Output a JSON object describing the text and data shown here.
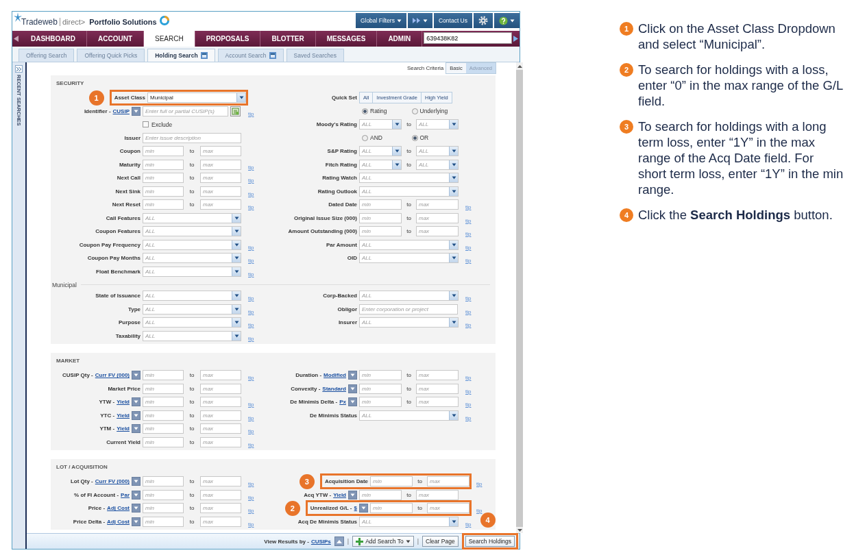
{
  "header": {
    "brand": "Tradeweb",
    "tagline": "direct>",
    "product": "Portfolio Solutions",
    "tools": [
      {
        "kind": "label",
        "label": "Global Filters",
        "menu": true
      },
      {
        "kind": "forward",
        "menu": true
      },
      {
        "kind": "label",
        "label": "Contact Us",
        "menu": false
      },
      {
        "kind": "gear",
        "menu": false
      },
      {
        "kind": "help",
        "menu": true
      }
    ]
  },
  "nav": {
    "tabs": [
      {
        "label": "DASHBOARD",
        "selected": false
      },
      {
        "label": "ACCOUNT",
        "selected": false
      },
      {
        "label": "SEARCH",
        "selected": true
      },
      {
        "label": "PROPOSALS",
        "selected": false
      },
      {
        "label": "BLOTTER",
        "selected": false
      },
      {
        "label": "MESSAGES",
        "selected": false
      },
      {
        "label": "ADMIN",
        "selected": false
      }
    ],
    "search": {
      "value": "639438K82"
    }
  },
  "subtabs": [
    {
      "label": "Offering Search",
      "selected": false,
      "icon": false
    },
    {
      "label": "Offering Quick Picks",
      "selected": false,
      "icon": false
    },
    {
      "label": "Holding Search",
      "selected": true,
      "icon": true
    },
    {
      "label": "Account Search",
      "selected": false,
      "icon": true
    },
    {
      "label": "Saved Searches",
      "selected": false,
      "icon": false
    }
  ],
  "sidebar": {
    "title": "RECENT SEARCHES"
  },
  "criteria": {
    "label": "Search Criteria",
    "modes": [
      {
        "label": "Basic",
        "selected": false
      },
      {
        "label": "Advanced",
        "selected": true
      }
    ]
  },
  "sections": [
    {
      "title": "SECURITY",
      "rows": [
        {
          "kind": "fields",
          "left": {
            "kind": "select",
            "label": "Asset Class",
            "value": "Municipal",
            "callout": {
              "number": "1"
            }
          },
          "right": {
            "kind": "buttons",
            "label": "Quick Set",
            "buttons": [
              "All",
              "Investment Grade",
              "High Yield"
            ]
          }
        },
        {
          "kind": "fields",
          "left": {
            "kind": "text",
            "label": "Identifier -",
            "link": "CUSIP",
            "menu": true,
            "placeholder": "Enter full or partial CUSIP(s)",
            "action": true,
            "tip": "tip"
          },
          "right": {
            "kind": "radios",
            "options": [
              {
                "label": "Rating",
                "selected": true
              },
              {
                "label": "Underlying",
                "selected": false
              }
            ]
          }
        },
        {
          "kind": "fields",
          "left": {
            "kind": "checkbox",
            "label": "Exclude",
            "checked": false
          },
          "right": {
            "kind": "select_range",
            "label": "Moody's Rating",
            "selects": [
              {
                "placeholder": "ALL"
              },
              {
                "placeholder": "ALL"
              }
            ],
            "sep": "to"
          }
        },
        {
          "kind": "fields",
          "left": {
            "kind": "text",
            "label": "Issuer",
            "placeholder": "Enter issue description"
          },
          "right": {
            "kind": "radios",
            "options": [
              {
                "label": "AND",
                "selected": false
              },
              {
                "label": "OR",
                "selected": true
              }
            ]
          }
        },
        {
          "kind": "fields",
          "left": {
            "kind": "range",
            "label": "Coupon",
            "inputs": [
              {
                "placeholder": "min"
              },
              {
                "placeholder": "max"
              }
            ],
            "sep": "to"
          },
          "right": {
            "kind": "select_range",
            "label": "S&P Rating",
            "selects": [
              {
                "placeholder": "ALL"
              },
              {
                "placeholder": "ALL"
              }
            ],
            "sep": "to"
          }
        },
        {
          "kind": "fields",
          "left": {
            "kind": "range",
            "label": "Maturity",
            "inputs": [
              {
                "placeholder": "min"
              },
              {
                "placeholder": "max"
              }
            ],
            "sep": "to",
            "tip": "tip"
          },
          "right": {
            "kind": "select_range",
            "label": "Fitch Rating",
            "selects": [
              {
                "placeholder": "ALL"
              },
              {
                "placeholder": "ALL"
              }
            ],
            "sep": "to"
          }
        },
        {
          "kind": "fields",
          "left": {
            "kind": "range",
            "label": "Next Call",
            "inputs": [
              {
                "placeholder": "min"
              },
              {
                "placeholder": "max"
              }
            ],
            "sep": "to",
            "tip": "tip"
          },
          "right": {
            "kind": "select",
            "label": "Rating Watch",
            "placeholder": "ALL"
          }
        },
        {
          "kind": "fields",
          "left": {
            "kind": "range",
            "label": "Next Sink",
            "inputs": [
              {
                "placeholder": "min"
              },
              {
                "placeholder": "max"
              }
            ],
            "sep": "to",
            "tip": "tip"
          },
          "right": {
            "kind": "select",
            "label": "Rating Outlook",
            "placeholder": "ALL"
          }
        },
        {
          "kind": "fields",
          "left": {
            "kind": "range",
            "label": "Next Reset",
            "inputs": [
              {
                "placeholder": "min"
              },
              {
                "placeholder": "max"
              }
            ],
            "sep": "to",
            "tip": "tip"
          },
          "right": {
            "kind": "range",
            "label": "Dated Date",
            "inputs": [
              {
                "placeholder": "min"
              },
              {
                "placeholder": "max"
              }
            ],
            "sep": "to",
            "tip": "tip"
          }
        },
        {
          "kind": "fields",
          "left": {
            "kind": "select",
            "label": "Call Features",
            "placeholder": "ALL"
          },
          "right": {
            "kind": "range",
            "label": "Original Issue Size (000)",
            "inputs": [
              {
                "placeholder": "min"
              },
              {
                "placeholder": "max"
              }
            ],
            "sep": "to",
            "tip": "tip"
          }
        },
        {
          "kind": "fields",
          "left": {
            "kind": "select",
            "label": "Coupon Features",
            "placeholder": "ALL"
          },
          "right": {
            "kind": "range",
            "label": "Amount Outstanding (000)",
            "inputs": [
              {
                "placeholder": "min"
              },
              {
                "placeholder": "max"
              }
            ],
            "sep": "to",
            "tip": "tip"
          }
        },
        {
          "kind": "fields",
          "left": {
            "kind": "select",
            "label": "Coupon Pay Frequency",
            "placeholder": "ALL",
            "tip": "tip"
          },
          "right": {
            "kind": "select",
            "label": "Par Amount",
            "placeholder": "ALL",
            "tip": "tip"
          }
        },
        {
          "kind": "fields",
          "left": {
            "kind": "select",
            "label": "Coupon Pay Months",
            "placeholder": "ALL",
            "tip": "tip"
          },
          "right": {
            "kind": "select",
            "label": "OID",
            "placeholder": "ALL",
            "tip": "tip"
          }
        },
        {
          "kind": "fields",
          "left": {
            "kind": "select",
            "label": "Float Benchmark",
            "placeholder": "ALL",
            "tip": "tip"
          }
        },
        {
          "kind": "divider",
          "label": "Municipal"
        },
        {
          "kind": "fields",
          "left": {
            "kind": "select",
            "label": "State of Issuance",
            "placeholder": "ALL",
            "tip": "tip"
          },
          "right": {
            "kind": "select",
            "label": "Corp-Backed",
            "placeholder": "ALL",
            "tip": "tip"
          }
        },
        {
          "kind": "fields",
          "left": {
            "kind": "select",
            "label": "Type",
            "placeholder": "ALL",
            "tip": "tip"
          },
          "right": {
            "kind": "text",
            "label": "Obligor",
            "placeholder": "Enter corporation or project",
            "tip": "tip"
          }
        },
        {
          "kind": "fields",
          "left": {
            "kind": "select",
            "label": "Purpose",
            "placeholder": "ALL",
            "tip": "tip"
          },
          "right": {
            "kind": "select",
            "label": "Insurer",
            "placeholder": "ALL",
            "tip": "tip"
          }
        },
        {
          "kind": "fields",
          "left": {
            "kind": "select",
            "label": "Taxability",
            "placeholder": "ALL",
            "tip": "tip"
          }
        }
      ]
    },
    {
      "title": "MARKET",
      "rows": [
        {
          "kind": "fields",
          "left": {
            "kind": "range",
            "label": "CUSIP Qty -",
            "link": "Curr FV (000)",
            "menu": true,
            "inputs": [
              {
                "placeholder": "min"
              },
              {
                "placeholder": "max"
              }
            ],
            "sep": "to",
            "tip": "tip"
          },
          "right": {
            "kind": "range",
            "label": "Duration -",
            "link": "Modified",
            "menu": true,
            "inputs": [
              {
                "placeholder": "min"
              },
              {
                "placeholder": "max"
              }
            ],
            "sep": "to",
            "tip": "tip"
          }
        },
        {
          "kind": "fields",
          "left": {
            "kind": "range",
            "label": "Market Price",
            "inputs": [
              {
                "placeholder": "min"
              },
              {
                "placeholder": "max"
              }
            ],
            "sep": "to"
          },
          "right": {
            "kind": "range",
            "label": "Convexity -",
            "link": "Standard",
            "menu": true,
            "inputs": [
              {
                "placeholder": "min"
              },
              {
                "placeholder": "max"
              }
            ],
            "sep": "to",
            "tip": "tip"
          }
        },
        {
          "kind": "fields",
          "left": {
            "kind": "range",
            "label": "YTW -",
            "link": "Yield",
            "menu": true,
            "inputs": [
              {
                "placeholder": "min"
              },
              {
                "placeholder": "max"
              }
            ],
            "sep": "to",
            "tip": "tip"
          },
          "right": {
            "kind": "range",
            "label": "De Minimis Delta -",
            "link": "Px",
            "menu": true,
            "inputs": [
              {
                "placeholder": "min"
              },
              {
                "placeholder": "max"
              }
            ],
            "sep": "to",
            "tip": "tip"
          }
        },
        {
          "kind": "fields",
          "left": {
            "kind": "range",
            "label": "YTC -",
            "link": "Yield",
            "menu": true,
            "inputs": [
              {
                "placeholder": "min"
              },
              {
                "placeholder": "max"
              }
            ],
            "sep": "to",
            "tip": "tip"
          },
          "right": {
            "kind": "select",
            "label": "De Minimis Status",
            "placeholder": "ALL",
            "tip": "tip"
          }
        },
        {
          "kind": "fields",
          "left": {
            "kind": "range",
            "label": "YTM -",
            "link": "Yield",
            "menu": true,
            "inputs": [
              {
                "placeholder": "min"
              },
              {
                "placeholder": "max"
              }
            ],
            "sep": "to",
            "tip": "tip"
          }
        },
        {
          "kind": "fields",
          "left": {
            "kind": "range",
            "label": "Current Yield",
            "inputs": [
              {
                "placeholder": "min"
              },
              {
                "placeholder": "max"
              }
            ],
            "sep": "to",
            "tip": "tip"
          }
        }
      ]
    },
    {
      "title": "LOT / ACQUISITION",
      "rows": [
        {
          "kind": "fields",
          "left": {
            "kind": "range",
            "label": "Lot Qty -",
            "link": "Curr FV (000)",
            "menu": true,
            "inputs": [
              {
                "placeholder": "min"
              },
              {
                "placeholder": "max"
              }
            ],
            "sep": "to",
            "tip": "tip"
          },
          "right": {
            "kind": "range",
            "label": "Acquisition Date",
            "inputs": [
              {
                "placeholder": "min"
              },
              {
                "placeholder": "max"
              }
            ],
            "sep": "to",
            "tip": "tip",
            "callout": {
              "number": "3"
            }
          }
        },
        {
          "kind": "fields",
          "left": {
            "kind": "range",
            "label": "% of FI Account -",
            "link": "Par",
            "menu": true,
            "inputs": [
              {
                "placeholder": "min"
              },
              {
                "placeholder": "max"
              }
            ],
            "sep": "to",
            "tip": "tip"
          },
          "right": {
            "kind": "range",
            "label": "Acq YTW -",
            "link": "Yield",
            "menu": true,
            "inputs": [
              {
                "placeholder": "min"
              },
              {
                "placeholder": "max"
              }
            ],
            "sep": "to"
          }
        },
        {
          "kind": "fields",
          "left": {
            "kind": "range",
            "label": "Price -",
            "link": "Adj Cost",
            "menu": true,
            "inputs": [
              {
                "placeholder": "min"
              },
              {
                "placeholder": "max"
              }
            ],
            "sep": "to",
            "tip": "tip"
          },
          "right": {
            "kind": "range",
            "label": "Unrealized G/L -",
            "link": "$",
            "menu": true,
            "inputs": [
              {
                "placeholder": "min"
              },
              {
                "placeholder": "max"
              }
            ],
            "sep": "to",
            "tip": "tip",
            "callout": {
              "number": "2"
            }
          }
        },
        {
          "kind": "fields",
          "left": {
            "kind": "range",
            "label": "Price Delta -",
            "link": "Adj Cost",
            "menu": true,
            "inputs": [
              {
                "placeholder": "min"
              },
              {
                "placeholder": "max"
              }
            ],
            "sep": "to",
            "tip": "tip"
          },
          "right": {
            "kind": "select",
            "label": "Acq De Minimis Status",
            "placeholder": "ALL",
            "tip": "tip"
          }
        }
      ]
    }
  ],
  "footer": {
    "items": [
      {
        "kind": "results",
        "label": "View Results by -",
        "link": "CUSIPs"
      },
      {
        "kind": "up"
      },
      {
        "kind": "sep",
        "text": "|"
      },
      {
        "kind": "add",
        "label": "Add Search To",
        "menu": true
      },
      {
        "kind": "sep",
        "text": "|"
      },
      {
        "kind": "plain",
        "label": "Clear Page"
      },
      {
        "kind": "plain",
        "label": "Search Holdings",
        "callout": {
          "number": "4"
        }
      }
    ]
  },
  "instructions": [
    {
      "number": "1",
      "text": "Click on the Asset Class Dropdown and select “Municipal”."
    },
    {
      "number": "2",
      "text": "To search for holdings with a loss, enter “0” in the max range of the G/L field."
    },
    {
      "number": "3",
      "text": "To search for holdings with a long term loss, enter “1Y” in the max range of the Acq Date field. For short term loss, enter “1Y” in the min range."
    },
    {
      "number": "4",
      "text": "Click the **Search Holdings** button."
    }
  ]
}
